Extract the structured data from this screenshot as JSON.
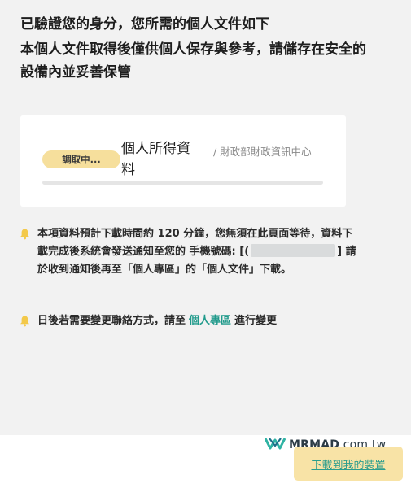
{
  "heading": {
    "line1": "已驗證您的身分，您所需的個人文件如下",
    "line2": "本個人文件取得後僅供個人保存與參考，請儲存在安全的設備內並妥善保管"
  },
  "document": {
    "status": "調取中...",
    "name": "個人所得資料",
    "issuer": "/ 財政部財政資訊中心",
    "progress": 0
  },
  "notice1": {
    "icon": "bell-icon",
    "text_before_phone": "本項資料預計下載時間約 120 分鐘，您無須在此頁面等待，資料下載完成後系統會發送通知至您的 手機號碼: [(",
    "text_after_phone": "] 請於收到通知後再至「個人專區」的「個人文件」下載。"
  },
  "notice2": {
    "icon": "bell-icon",
    "text_before_link": "日後若需要變更聯絡方式，請至",
    "link_label": "個人專區",
    "text_after_link": "進行變更"
  },
  "watermark": {
    "brand": "MRMAD",
    "domain": ".com.tw"
  },
  "footer": {
    "download_label": "下載到我的裝置"
  },
  "colors": {
    "page_bg": "#f2f2f2",
    "pill_bg": "#f6df9c",
    "link": "#1f9a8b",
    "button_bg": "#f8e3a6"
  }
}
